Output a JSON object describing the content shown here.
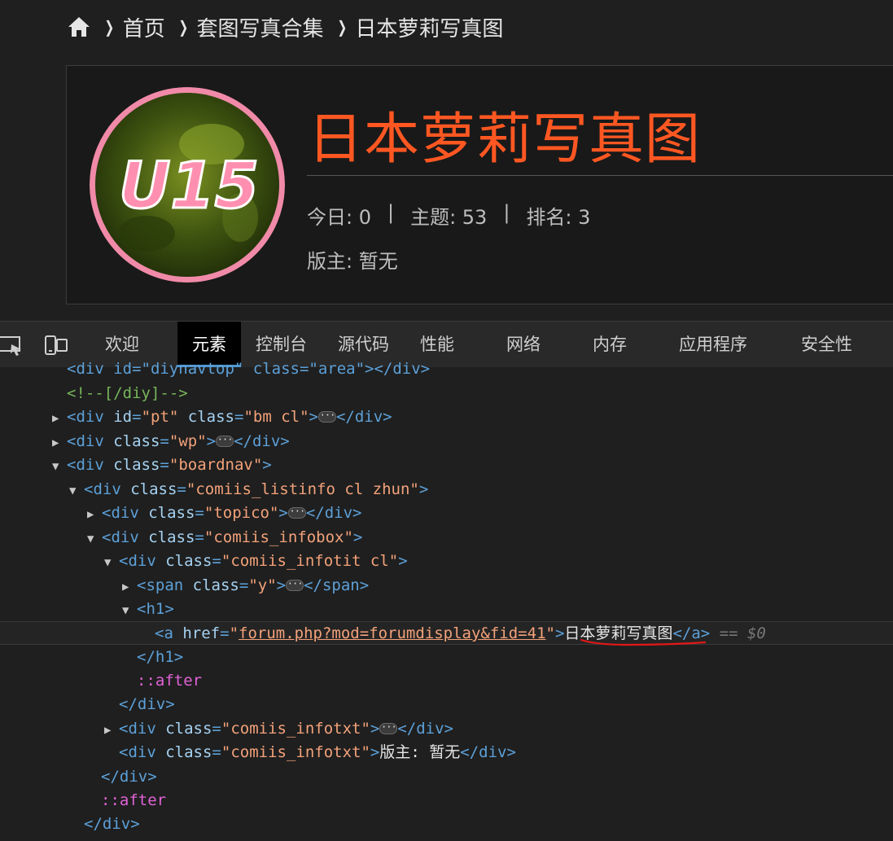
{
  "breadcrumb": {
    "home_icon": "home-icon",
    "items": [
      "首页",
      "套图写真合集",
      "日本萝莉写真图"
    ]
  },
  "forum": {
    "logo_text": "U15",
    "title": "日本萝莉写真图",
    "today_label": "今日: 0",
    "topics_label": "主题: 53",
    "rank_label": "排名: 3",
    "separator": "|",
    "moderator": "版主: 暂无",
    "title_color": "#ff5722"
  },
  "devtools": {
    "tabs": [
      "欢迎",
      "元素",
      "控制台",
      "源代码",
      "性能",
      "网络",
      "内存",
      "应用程序",
      "安全性"
    ],
    "active_tab": "元素",
    "tree": {
      "l0": {
        "pre": "<div id=\"diynavtop\" class=\"area\"></div>"
      },
      "l1": {
        "comment": "<!--[/diy]-->"
      },
      "l2": {
        "open": "<div",
        "a1": "id",
        "v1": "\"pt\"",
        "a2": "class",
        "v2": "\"bm cl\"",
        "close": "</div>"
      },
      "l3": {
        "open": "<div",
        "a1": "class",
        "v1": "\"wp\"",
        "close": "</div>"
      },
      "l4": {
        "open": "<div",
        "a1": "class",
        "v1": "\"boardnav\""
      },
      "l5": {
        "open": "<div",
        "a1": "class",
        "v1": "\"comiis_listinfo cl zhun\""
      },
      "l6": {
        "open": "<div",
        "a1": "class",
        "v1": "\"topico\"",
        "close": "</div>"
      },
      "l7": {
        "open": "<div",
        "a1": "class",
        "v1": "\"comiis_infobox\""
      },
      "l8": {
        "open": "<div",
        "a1": "class",
        "v1": "\"comiis_infotit cl\""
      },
      "l9": {
        "open": "<span",
        "a1": "class",
        "v1": "\"y\"",
        "close": "</span>"
      },
      "l10": {
        "open": "<h1>"
      },
      "l11": {
        "open": "<a",
        "a1": "href",
        "v1": "forum.php?mod=forumdisplay&fid=41",
        "text": "日本萝莉写真图",
        "close": "</a>",
        "marker": "== $0"
      },
      "l12": {
        "close": "</h1>"
      },
      "l13": {
        "pseudo": "::after"
      },
      "l14": {
        "close": "</div>"
      },
      "l15": {
        "open": "<div",
        "a1": "class",
        "v1": "\"comiis_infotxt\"",
        "close": "</div>"
      },
      "l16": {
        "open": "<div",
        "a1": "class",
        "v1": "\"comiis_infotxt\"",
        "text": "版主: 暂无",
        "close": "</div>"
      },
      "l17": {
        "close": "</div>"
      },
      "l18": {
        "pseudo": "::after"
      },
      "l19": {
        "close": "</div>"
      }
    }
  }
}
